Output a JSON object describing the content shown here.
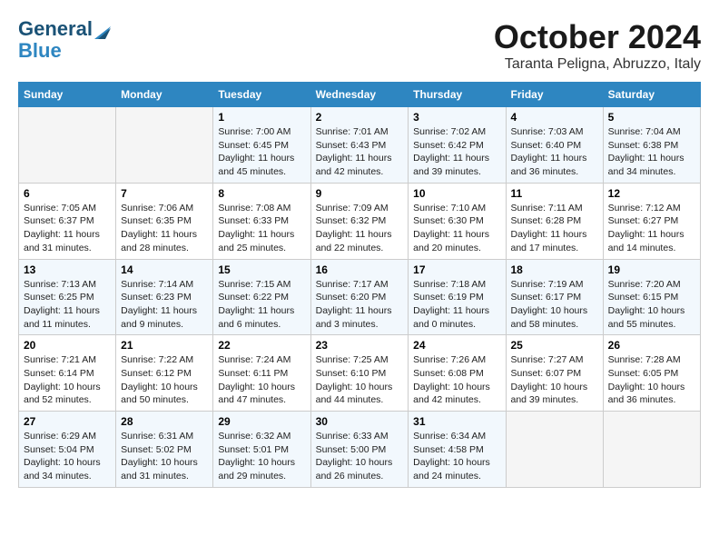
{
  "header": {
    "logo_line1": "General",
    "logo_line2": "Blue",
    "month": "October 2024",
    "location": "Taranta Peligna, Abruzzo, Italy"
  },
  "days_of_week": [
    "Sunday",
    "Monday",
    "Tuesday",
    "Wednesday",
    "Thursday",
    "Friday",
    "Saturday"
  ],
  "weeks": [
    [
      {
        "day": "",
        "info": ""
      },
      {
        "day": "",
        "info": ""
      },
      {
        "day": "1",
        "info": "Sunrise: 7:00 AM\nSunset: 6:45 PM\nDaylight: 11 hours and 45 minutes."
      },
      {
        "day": "2",
        "info": "Sunrise: 7:01 AM\nSunset: 6:43 PM\nDaylight: 11 hours and 42 minutes."
      },
      {
        "day": "3",
        "info": "Sunrise: 7:02 AM\nSunset: 6:42 PM\nDaylight: 11 hours and 39 minutes."
      },
      {
        "day": "4",
        "info": "Sunrise: 7:03 AM\nSunset: 6:40 PM\nDaylight: 11 hours and 36 minutes."
      },
      {
        "day": "5",
        "info": "Sunrise: 7:04 AM\nSunset: 6:38 PM\nDaylight: 11 hours and 34 minutes."
      }
    ],
    [
      {
        "day": "6",
        "info": "Sunrise: 7:05 AM\nSunset: 6:37 PM\nDaylight: 11 hours and 31 minutes."
      },
      {
        "day": "7",
        "info": "Sunrise: 7:06 AM\nSunset: 6:35 PM\nDaylight: 11 hours and 28 minutes."
      },
      {
        "day": "8",
        "info": "Sunrise: 7:08 AM\nSunset: 6:33 PM\nDaylight: 11 hours and 25 minutes."
      },
      {
        "day": "9",
        "info": "Sunrise: 7:09 AM\nSunset: 6:32 PM\nDaylight: 11 hours and 22 minutes."
      },
      {
        "day": "10",
        "info": "Sunrise: 7:10 AM\nSunset: 6:30 PM\nDaylight: 11 hours and 20 minutes."
      },
      {
        "day": "11",
        "info": "Sunrise: 7:11 AM\nSunset: 6:28 PM\nDaylight: 11 hours and 17 minutes."
      },
      {
        "day": "12",
        "info": "Sunrise: 7:12 AM\nSunset: 6:27 PM\nDaylight: 11 hours and 14 minutes."
      }
    ],
    [
      {
        "day": "13",
        "info": "Sunrise: 7:13 AM\nSunset: 6:25 PM\nDaylight: 11 hours and 11 minutes."
      },
      {
        "day": "14",
        "info": "Sunrise: 7:14 AM\nSunset: 6:23 PM\nDaylight: 11 hours and 9 minutes."
      },
      {
        "day": "15",
        "info": "Sunrise: 7:15 AM\nSunset: 6:22 PM\nDaylight: 11 hours and 6 minutes."
      },
      {
        "day": "16",
        "info": "Sunrise: 7:17 AM\nSunset: 6:20 PM\nDaylight: 11 hours and 3 minutes."
      },
      {
        "day": "17",
        "info": "Sunrise: 7:18 AM\nSunset: 6:19 PM\nDaylight: 11 hours and 0 minutes."
      },
      {
        "day": "18",
        "info": "Sunrise: 7:19 AM\nSunset: 6:17 PM\nDaylight: 10 hours and 58 minutes."
      },
      {
        "day": "19",
        "info": "Sunrise: 7:20 AM\nSunset: 6:15 PM\nDaylight: 10 hours and 55 minutes."
      }
    ],
    [
      {
        "day": "20",
        "info": "Sunrise: 7:21 AM\nSunset: 6:14 PM\nDaylight: 10 hours and 52 minutes."
      },
      {
        "day": "21",
        "info": "Sunrise: 7:22 AM\nSunset: 6:12 PM\nDaylight: 10 hours and 50 minutes."
      },
      {
        "day": "22",
        "info": "Sunrise: 7:24 AM\nSunset: 6:11 PM\nDaylight: 10 hours and 47 minutes."
      },
      {
        "day": "23",
        "info": "Sunrise: 7:25 AM\nSunset: 6:10 PM\nDaylight: 10 hours and 44 minutes."
      },
      {
        "day": "24",
        "info": "Sunrise: 7:26 AM\nSunset: 6:08 PM\nDaylight: 10 hours and 42 minutes."
      },
      {
        "day": "25",
        "info": "Sunrise: 7:27 AM\nSunset: 6:07 PM\nDaylight: 10 hours and 39 minutes."
      },
      {
        "day": "26",
        "info": "Sunrise: 7:28 AM\nSunset: 6:05 PM\nDaylight: 10 hours and 36 minutes."
      }
    ],
    [
      {
        "day": "27",
        "info": "Sunrise: 6:29 AM\nSunset: 5:04 PM\nDaylight: 10 hours and 34 minutes."
      },
      {
        "day": "28",
        "info": "Sunrise: 6:31 AM\nSunset: 5:02 PM\nDaylight: 10 hours and 31 minutes."
      },
      {
        "day": "29",
        "info": "Sunrise: 6:32 AM\nSunset: 5:01 PM\nDaylight: 10 hours and 29 minutes."
      },
      {
        "day": "30",
        "info": "Sunrise: 6:33 AM\nSunset: 5:00 PM\nDaylight: 10 hours and 26 minutes."
      },
      {
        "day": "31",
        "info": "Sunrise: 6:34 AM\nSunset: 4:58 PM\nDaylight: 10 hours and 24 minutes."
      },
      {
        "day": "",
        "info": ""
      },
      {
        "day": "",
        "info": ""
      }
    ]
  ]
}
